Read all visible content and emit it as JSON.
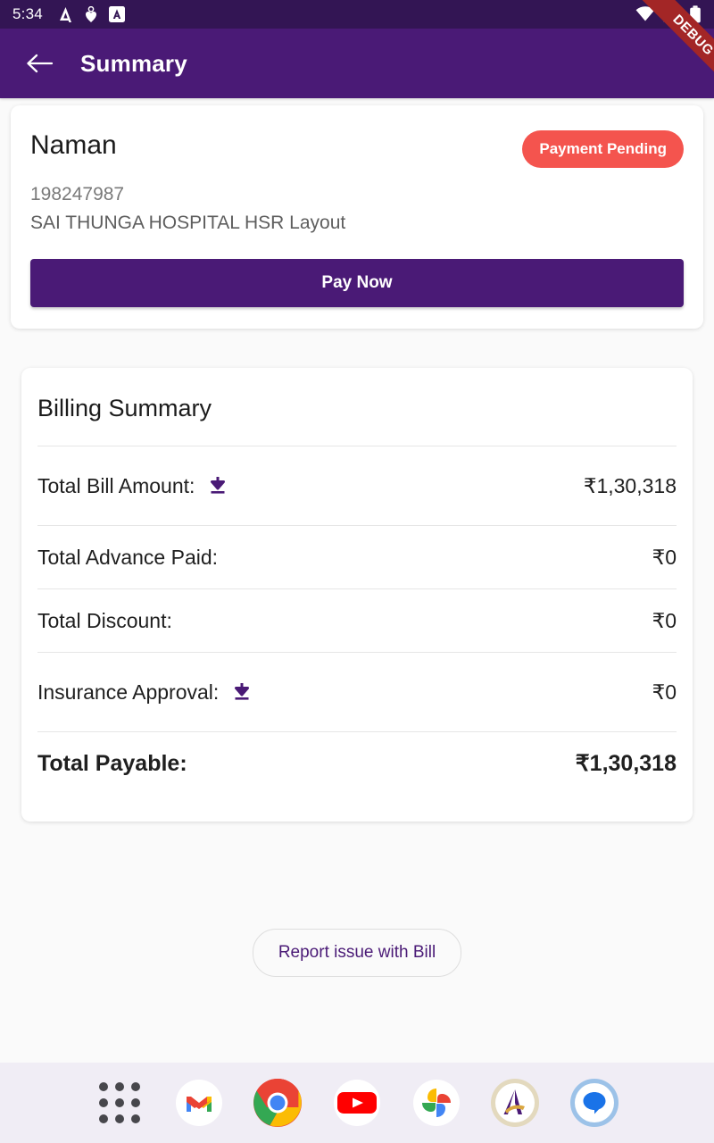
{
  "status_bar": {
    "time": "5:34",
    "left_icons": [
      "activity-app-icon",
      "heart-pin-icon",
      "a-badge-icon"
    ],
    "right_icons": [
      "wifi-icon",
      "cellular-signal-icon",
      "battery-icon"
    ]
  },
  "debug_ribbon": {
    "label": "DEBUG",
    "color": "#A32626"
  },
  "app_bar": {
    "back_icon": "back-arrow-icon",
    "title": "Summary",
    "color": "#4A1A76"
  },
  "patient_card": {
    "name": "Naman",
    "status_badge": "Payment Pending",
    "status_color": "#F4544E",
    "patient_id": "198247987",
    "hospital": "SAI THUNGA HOSPITAL HSR Layout",
    "pay_button": "Pay Now"
  },
  "billing": {
    "title": "Billing Summary",
    "rows": [
      {
        "label": "Total Bill Amount:",
        "value": "₹1,30,318",
        "download": true,
        "bold": false
      },
      {
        "label": "Total Advance Paid:",
        "value": "₹0",
        "download": false,
        "bold": false
      },
      {
        "label": "Total Discount:",
        "value": "₹0",
        "download": false,
        "bold": false
      },
      {
        "label": "Insurance Approval:",
        "value": "₹0",
        "download": true,
        "bold": false
      },
      {
        "label": "Total Payable:",
        "value": "₹1,30,318",
        "download": false,
        "bold": true
      }
    ]
  },
  "report_button": {
    "label": "Report issue with Bill"
  },
  "dock": {
    "items": [
      {
        "name": "app-drawer-icon"
      },
      {
        "name": "gmail-icon"
      },
      {
        "name": "chrome-icon"
      },
      {
        "name": "youtube-icon"
      },
      {
        "name": "google-photos-icon"
      },
      {
        "name": "a-app-icon"
      },
      {
        "name": "google-messages-icon"
      }
    ]
  }
}
